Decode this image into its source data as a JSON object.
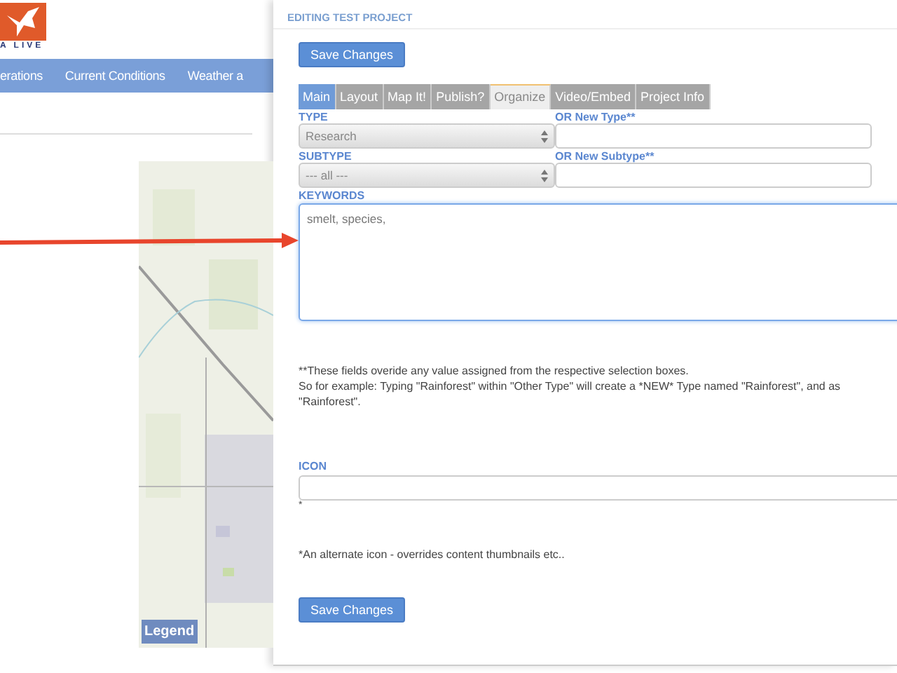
{
  "site": {
    "logo_text": "A LIVE",
    "nav": [
      "erations",
      "Current Conditions",
      "Weather a"
    ]
  },
  "map": {
    "kind": "picture",
    "legend_button": "Legend"
  },
  "annotation": {
    "kind": "arrow"
  },
  "panel": {
    "title": "EDITING TEST PROJECT",
    "save_top": "Save Changes",
    "tabs": [
      {
        "label": "Main",
        "selected": false,
        "hover": true
      },
      {
        "label": "Layout",
        "selected": false,
        "hover": false
      },
      {
        "label": "Map It!",
        "selected": false,
        "hover": false
      },
      {
        "label": "Publish?",
        "selected": false,
        "hover": false
      },
      {
        "label": "Organize",
        "selected": true,
        "hover": false
      },
      {
        "label": "Video/Embed",
        "selected": false,
        "hover": false
      },
      {
        "label": "Project Info",
        "selected": false,
        "hover": false
      }
    ],
    "type": {
      "label": "TYPE",
      "value": "Research",
      "new_label": "OR New Type**"
    },
    "subtype": {
      "label": "SUBTYPE",
      "value": "--- all ---",
      "new_label": "OR New Subtype**"
    },
    "keywords": {
      "label": "KEYWORDS",
      "value": "smelt, species,",
      "focused": true
    },
    "note": [
      "**These fields overide any value assigned from the respective selection boxes.",
      "So for example: Typing \"Rainforest\" within \"Other Type\" will create a *NEW* Type named \"Rainforest\", and as",
      "\"Rainforest\"."
    ],
    "icon": {
      "label": "ICON",
      "mark": "*",
      "hint": "*An alternate icon - overrides content thumbnails etc.."
    },
    "save_bottom": "Save Changes"
  }
}
